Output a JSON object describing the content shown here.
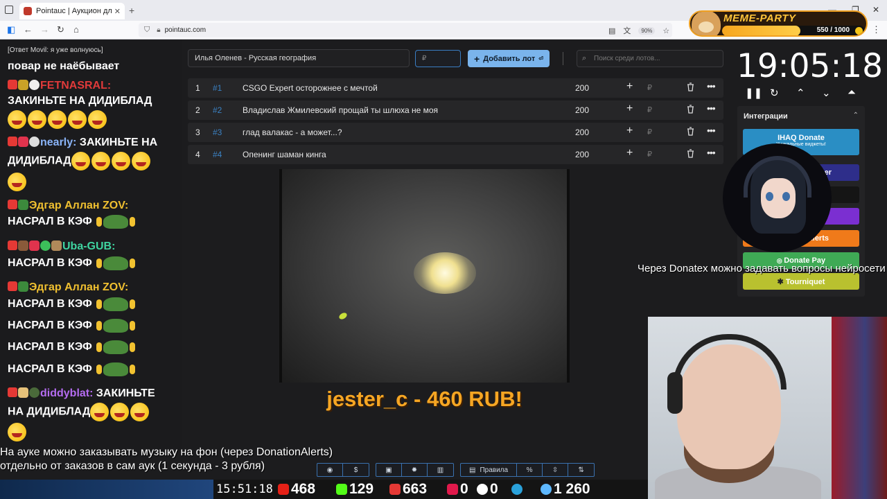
{
  "browser": {
    "tab_title": "Pointauc | Аукцион для стрима",
    "url": "pointauc.com",
    "zoom": "90%"
  },
  "meme_party": {
    "title": "MEME-PARTY",
    "progress_text": "550 / 1000",
    "progress_value": 0.55
  },
  "chat": {
    "reply": "Ответ Movil: я уже волнуюсь]",
    "messages": [
      {
        "user": "",
        "text": "повар не наёбывает"
      },
      {
        "user": "FETNASRAL:",
        "text": ""
      },
      {
        "user": "",
        "text": "ЗАКИНЬТЕ НА ДИДИБЛАД"
      },
      {
        "user": "nearly:",
        "text": "ЗАКИНЬТЕ НА"
      },
      {
        "user": "",
        "text": "ДИДИБЛАД"
      },
      {
        "user": "Эдгар Аллан ZOV:",
        "text": ""
      },
      {
        "user": "",
        "text": "НАСРАЛ В КЭФ"
      },
      {
        "user": "Uba-GUB:",
        "text": ""
      },
      {
        "user": "",
        "text": "НАСРАЛ В КЭФ"
      },
      {
        "user": "Эдгар Аллан ZOV:",
        "text": ""
      },
      {
        "user": "",
        "text": "НАСРАЛ В КЭФ"
      },
      {
        "user": "",
        "text": "НАСРАЛ В КЭФ"
      },
      {
        "user": "",
        "text": "НАСРАЛ В КЭФ"
      },
      {
        "user": "",
        "text": "НАСРАЛ В КЭФ"
      },
      {
        "user": "diddyblat:",
        "text": "ЗАКИНЬТЕ"
      },
      {
        "user": "",
        "text": "НА ДИДИБЛАД"
      }
    ]
  },
  "auction": {
    "lot_input_value": "Илья Оленев - Русская география",
    "price_placeholder": "₽",
    "add_button": "Добавить лот",
    "search_placeholder": "Поиск среди лотов...",
    "lots": [
      {
        "index": "1",
        "id": "#1",
        "name": "CSGO Expert осторожнее с мечтой",
        "amount": "200"
      },
      {
        "index": "2",
        "id": "#2",
        "name": "Владислав Жмилевский прощай ты шлюха не моя",
        "amount": "200"
      },
      {
        "index": "3",
        "id": "#3",
        "name": "глад валакас - а может...?",
        "amount": "200"
      },
      {
        "index": "4",
        "id": "#4",
        "name": "Опенинг шаман кинга",
        "amount": "200"
      }
    ],
    "currency_symbol": "₽"
  },
  "donation": {
    "text": "jester_c - 460 RUB!"
  },
  "timer": {
    "value": "19:05:18"
  },
  "integrations": {
    "header": "Интеграции",
    "buttons": [
      {
        "label": "IHAQ Donate",
        "sub": "Уникальные виджеты!",
        "color": "#2a8ec4"
      },
      {
        "label": "er",
        "color": "#2e2e8a"
      },
      {
        "label": "",
        "color": "#1a1a1a"
      },
      {
        "label": "",
        "color": "#7b2fd1"
      },
      {
        "label": "Alerts",
        "color": "#f07a1a"
      },
      {
        "label": "Donate Pay",
        "color": "#3faa55"
      },
      {
        "label": "Tourniquet",
        "color": "#b9c12f"
      }
    ]
  },
  "overlay_text": "Через Donatex можно задавать вопросы нейросети",
  "bottom": {
    "line1": "На ауке можно заказывать музыку на фон (через DonationAlerts)",
    "line2": "отдельно от заказов в сам аук (1 секунда - 3 рубля)",
    "rules_label": "Правила",
    "clock": "15:51:18",
    "stats": [
      {
        "name": "youtube",
        "value": "468",
        "color": "#e62117"
      },
      {
        "name": "kick",
        "value": "129",
        "color": "#53fc18"
      },
      {
        "name": "vk-live",
        "value": "663",
        "color": "#e53935"
      },
      {
        "name": "rutube",
        "value": "0",
        "color": "#e0194b"
      },
      {
        "name": "r",
        "value": "0",
        "color": "#ffffff"
      },
      {
        "name": "telegram",
        "value": "",
        "color": "#2aa1da"
      },
      {
        "name": "viewers",
        "value": "1 260",
        "color": "#5eb8ff"
      }
    ]
  }
}
